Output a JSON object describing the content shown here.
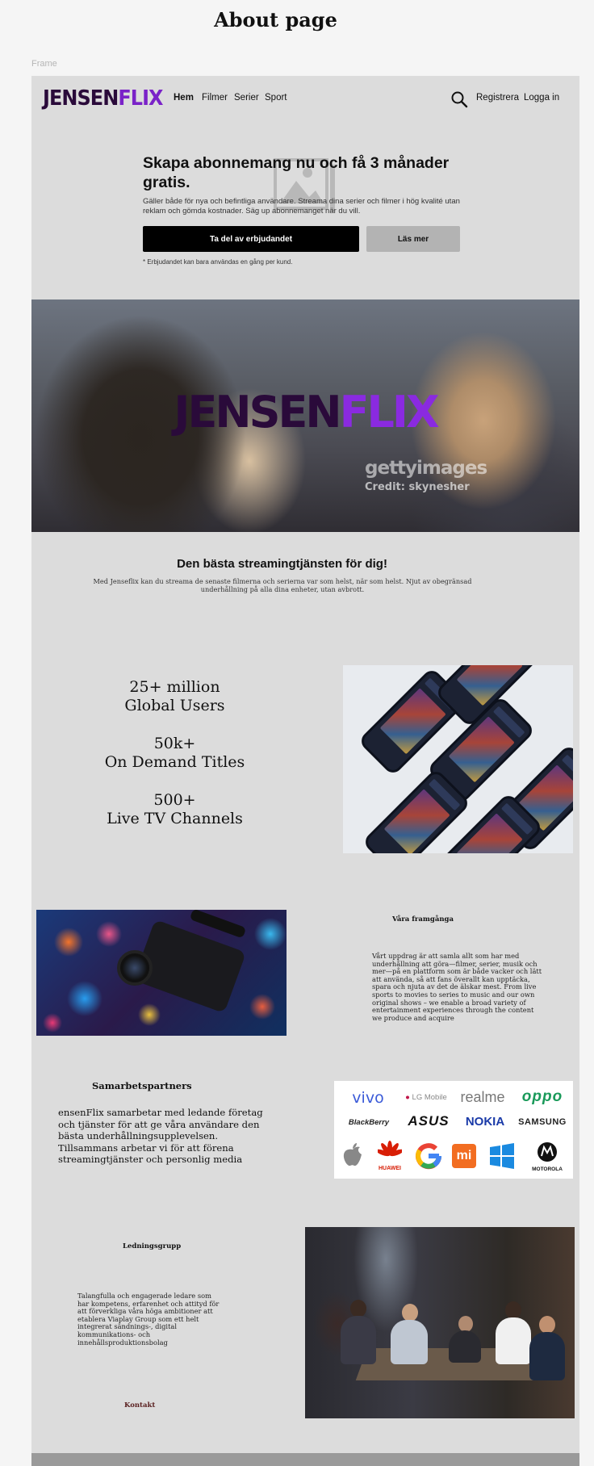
{
  "page_title": "About page",
  "frame_label": "Frame",
  "nav": {
    "logo_part1": "JENSEN",
    "logo_part2": "FLIX",
    "items": [
      {
        "label": "Hem",
        "active": true
      },
      {
        "label": "Filmer",
        "active": false
      },
      {
        "label": "Serier",
        "active": false
      },
      {
        "label": "Sport",
        "active": false
      }
    ],
    "register": "Registrera",
    "login": "Logga in",
    "icon": "search-icon"
  },
  "promo": {
    "title": "Skapa abonnemang nu och få 3 månader gratis.",
    "text": "Gäller både för nya och befintliga användare. Streama dina serier och filmer i hög kvalité utan reklam och gömda kostnader. Säg up abonnemanget när du vill.",
    "primary_button": "Ta del av erbjudandet",
    "secondary_button": "Läs mer",
    "footnote": "* Erbjudandet kan bara användas en gång per kund."
  },
  "hero": {
    "logo_part1": "JENSEN",
    "logo_part2": "FLIX",
    "watermark": "gettyimages",
    "credit": "Credit: skynesher"
  },
  "best": {
    "title": "Den bästa streamingtjänsten för dig!",
    "text": "Med Jenseflix kan du streama de senaste filmerna och serierna var som helst, när som helst. Njut av obegränsad underhållning på alla dina enheter, utan avbrott."
  },
  "stats": [
    {
      "value": "25+ million",
      "label": "Global Users"
    },
    {
      "value": "50k+",
      "label": "On Demand Titles"
    },
    {
      "value": "500+",
      "label": "Live TV Channels"
    }
  ],
  "success": {
    "title": "Våra framgånga",
    "text": "Vårt uppdrag är att samla allt som har med underhållning att göra—filmer, serier, musik och mer—på en plattform som är både vacker och lätt att använda, så att fans överallt kan upptäcka, spara och njuta av det de älskar mest. From live sports to movies to series to music and our own original shows – we enable a broad variety of entertainment experiences through the content we produce and acquire"
  },
  "partners": {
    "title": "Samarbetspartners",
    "text": "ensenFlix samarbetar med ledande företag och tjänster för att ge våra användare den bästa underhållningsupplevelsen. Tillsammans arbetar vi för att förena streamingtjänster och personlig media",
    "brands": [
      "vivo",
      "LG Mobile",
      "realme",
      "oppo",
      "BlackBerry",
      "ASUS",
      "NOKIA",
      "SAMSUNG",
      "HUAWEI",
      "MOTOROLA"
    ]
  },
  "leadership": {
    "title": "Ledningsgrupp",
    "text": "Talangfulla och engagerade ledare som har kompetens, erfarenhet och attityd för att förverkliga våra höga ambitioner att etablera Viaplay Group som ett helt integrerat sändnings-, digital kommunikations- och innehållsproduktionsbolag",
    "contact": "Kontakt"
  },
  "colors": {
    "logo_dark": "#2a0a3a",
    "logo_purple": "#7a22c8",
    "frame_bg": "#dcdcdc",
    "button_primary": "#000000",
    "button_secondary": "#b3b3b3"
  }
}
